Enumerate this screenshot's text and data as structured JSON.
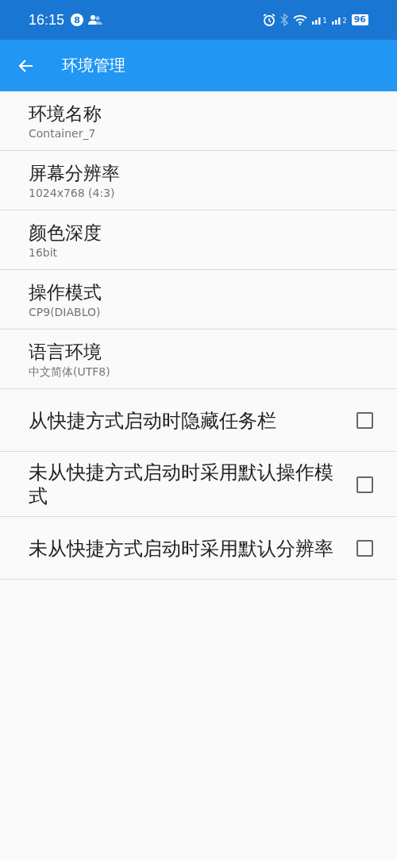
{
  "status_bar": {
    "time": "16:15",
    "notification_count": "8",
    "sim_labels": [
      "1",
      "2"
    ],
    "battery": "96"
  },
  "app_bar": {
    "title": "环境管理"
  },
  "settings": [
    {
      "kind": "value",
      "title": "环境名称",
      "value": "Container_7"
    },
    {
      "kind": "value",
      "title": "屏幕分辨率",
      "value": "1024x768 (4:3)"
    },
    {
      "kind": "value",
      "title": "颜色深度",
      "value": "16bit"
    },
    {
      "kind": "value",
      "title": "操作模式",
      "value": "CP9(DIABLO)"
    },
    {
      "kind": "value",
      "title": "语言环境",
      "value": "中文简体(UTF8)"
    },
    {
      "kind": "checkbox",
      "title": "从快捷方式启动时隐藏任务栏",
      "checked": false
    },
    {
      "kind": "checkbox",
      "title": "未从快捷方式启动时采用默认操作模式",
      "checked": false
    },
    {
      "kind": "checkbox",
      "title": "未从快捷方式启动时采用默认分辨率",
      "checked": false
    }
  ]
}
